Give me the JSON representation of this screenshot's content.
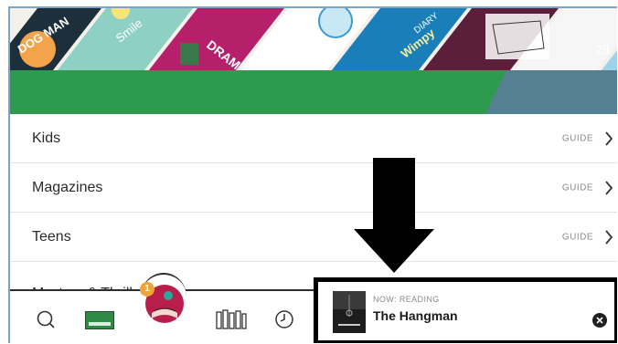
{
  "banner": {
    "book_covers": [
      "Dog Man",
      "Smile",
      "Drama",
      "Diary of a Wimpy Kid"
    ]
  },
  "categories": [
    {
      "label": "Kids",
      "action": "GUIDE"
    },
    {
      "label": "Magazines",
      "action": "GUIDE"
    },
    {
      "label": "Teens",
      "action": "GUIDE"
    },
    {
      "label": "Mystery & Thrille",
      "action": ""
    }
  ],
  "bottom_nav": {
    "items": [
      "search-icon",
      "library-card-icon",
      "profile-avatar",
      "shelf-icon",
      "history-icon"
    ],
    "badge_count": "1"
  },
  "now_reading": {
    "kicker": "NOW: READING",
    "title": "The Hangman"
  },
  "colors": {
    "accent_green": "#2e9a4e",
    "slate_blue": "#557f93",
    "arrow": "#000000"
  }
}
